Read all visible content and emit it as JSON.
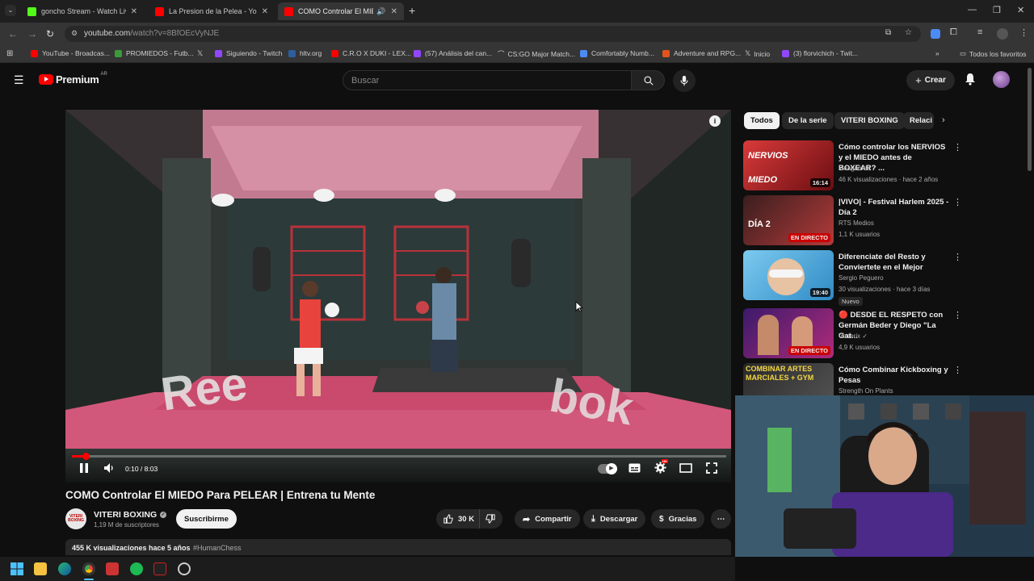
{
  "browser": {
    "tabs": [
      {
        "title": "goncho Stream - Watch Live on",
        "favicon_color": "#53fc18",
        "active": false
      },
      {
        "title": "La Presion de la Pelea - YouTub",
        "favicon_color": "#ff0000",
        "active": false
      },
      {
        "title": "COMO Controlar El MIEDO",
        "favicon_color": "#ff0000",
        "active": true
      }
    ],
    "url_host": "youtube.com",
    "url_path": "/watch?v=8BfOEcVyNJE",
    "bookmarks": [
      "YouTube - Broadcas...",
      "PROMIEDOS - Futb...",
      "Siguiendo - Twitch",
      "hltv.org",
      "C.R.O X DUKI - LEX...",
      "(57) Análisis del can...",
      "CS:GO Major Match...",
      "Comfortably Numb...",
      "Adventure and RPG...",
      "Inicio",
      "(3) florvichich - Twit..."
    ],
    "bookmarks_all": "Todos los favoritos"
  },
  "youtube": {
    "logo_text": "Premium",
    "region": "AR",
    "search_placeholder": "Buscar",
    "create_label": "Crear",
    "player": {
      "time_current": "0:10",
      "time_sep": " / ",
      "time_total": "8:03",
      "progress_fraction": 0.021
    },
    "video_title": "COMO Controlar El MIEDO Para PELEAR | Entrena tu Mente",
    "channel": {
      "name": "VITERI BOXING",
      "subscribers": "1,19 M de suscriptores",
      "avatar_text": "VITERI BOXING"
    },
    "subscribe_label": "Suscribirme",
    "actions": {
      "likes": "30 K",
      "share": "Compartir",
      "download": "Descargar",
      "thanks": "Gracias"
    },
    "description": {
      "views": "455 K visualizaciones",
      "age": "hace 5 años",
      "hashtag": "#HumanChess"
    },
    "chips": [
      "Todos",
      "De la serie",
      "VITERI BOXING",
      "Relaci"
    ],
    "recommendations": [
      {
        "title": "Cómo controlar los NERVIOS y el MIEDO antes de BOXEAR? ...",
        "channel": "leaagomez",
        "meta": "46 K visualizaciones · hace 2 años",
        "duration": "16:14",
        "thumb_text": "NERVIOS MIEDO",
        "thumb_color": "#b8262a"
      },
      {
        "title": "|VIVO| - Festival Harlem 2025 - Día 2",
        "channel": "RTS Medios",
        "meta": "1,1 K usuarios",
        "live": "EN DIRECTO",
        "thumb_text": "DÍA 2",
        "thumb_color": "#7a2020"
      },
      {
        "title": "Diferenciate del Resto y Conviertete en el Mejor",
        "channel": "Sergio Peguero",
        "meta": "30 visualizaciones · hace 3 días",
        "duration": "19:40",
        "badge": "Nuevo",
        "thumb_color": "#4aa6d8"
      },
      {
        "title": "🔴 DESDE EL RESPETO con Germán Beder y Diego \"La Gat...",
        "channel": "Vorterix",
        "meta": "4,9 K usuarios",
        "live": "EN DIRECTO",
        "thumb_color": "#5b2a8a"
      },
      {
        "title": "Cómo Combinar Kickboxing y Pesas",
        "channel": "Strength On Plants",
        "thumb_text": "COMBINAR ARTES MARCIALES + GYM",
        "thumb_color": "#2a2a2a"
      }
    ]
  }
}
